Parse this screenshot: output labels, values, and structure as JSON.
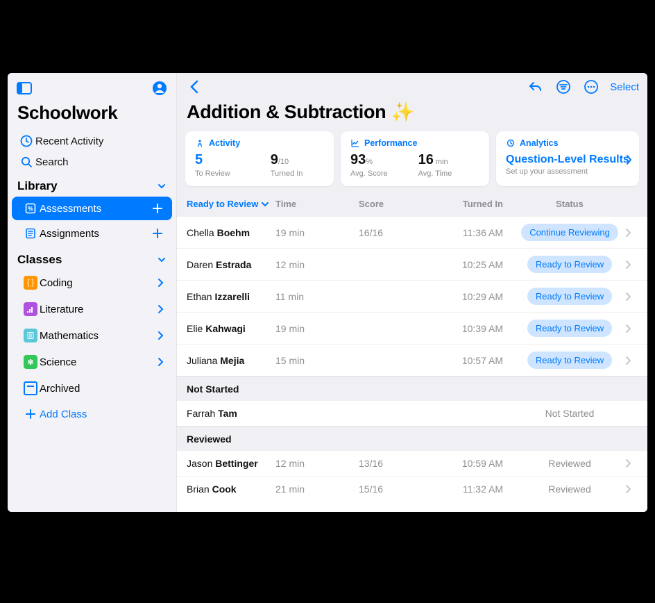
{
  "sidebar": {
    "app_title": "Schoolwork",
    "recent_label": "Recent Activity",
    "search_label": "Search",
    "library_header": "Library",
    "library_items": [
      {
        "label": "Assessments"
      },
      {
        "label": "Assignments"
      }
    ],
    "classes_header": "Classes",
    "class_items": [
      {
        "label": "Coding"
      },
      {
        "label": "Literature"
      },
      {
        "label": "Mathematics"
      },
      {
        "label": "Science"
      },
      {
        "label": "Archived"
      }
    ],
    "add_class_label": "Add Class"
  },
  "header": {
    "select_label": "Select",
    "page_title": "Addition & Subtraction ✨"
  },
  "cards": {
    "activity": {
      "title": "Activity",
      "to_review_value": "5",
      "to_review_label": "To Review",
      "turned_in_value": "9",
      "turned_in_denom": "/10",
      "turned_in_label": "Turned In"
    },
    "performance": {
      "title": "Performance",
      "avg_score_value": "93",
      "avg_score_unit": "%",
      "avg_score_label": "Avg. Score",
      "avg_time_value": "16",
      "avg_time_unit": " min",
      "avg_time_label": "Avg. Time"
    },
    "analytics": {
      "title": "Analytics",
      "qlr_title": "Question-Level Results",
      "qlr_sub": "Set up your assessment"
    }
  },
  "table": {
    "col_ready": "Ready to Review",
    "col_time": "Time",
    "col_score": "Score",
    "col_turned_in": "Turned In",
    "col_status": "Status",
    "section_not_started": "Not Started",
    "section_reviewed": "Reviewed",
    "status_not_started": "Not Started",
    "status_reviewed": "Reviewed",
    "ready_rows": [
      {
        "first": "Chella",
        "last": "Boehm",
        "time": "19 min",
        "score": "16/16",
        "turned": "11:36 AM",
        "status": "Continue Reviewing"
      },
      {
        "first": "Daren",
        "last": "Estrada",
        "time": "12 min",
        "score": "",
        "turned": "10:25 AM",
        "status": "Ready to Review"
      },
      {
        "first": "Ethan",
        "last": "Izzarelli",
        "time": "11 min",
        "score": "",
        "turned": "10:29 AM",
        "status": "Ready to Review"
      },
      {
        "first": "Elie",
        "last": "Kahwagi",
        "time": "19 min",
        "score": "",
        "turned": "10:39 AM",
        "status": "Ready to Review"
      },
      {
        "first": "Juliana",
        "last": "Mejia",
        "time": "15 min",
        "score": "",
        "turned": "10:57 AM",
        "status": "Ready to Review"
      }
    ],
    "not_started_rows": [
      {
        "first": "Farrah",
        "last": "Tam"
      }
    ],
    "reviewed_rows": [
      {
        "first": "Jason",
        "last": "Bettinger",
        "time": "12 min",
        "score": "13/16",
        "turned": "10:59 AM"
      },
      {
        "first": "Brian",
        "last": "Cook",
        "time": "21 min",
        "score": "15/16",
        "turned": "11:32 AM"
      }
    ]
  }
}
